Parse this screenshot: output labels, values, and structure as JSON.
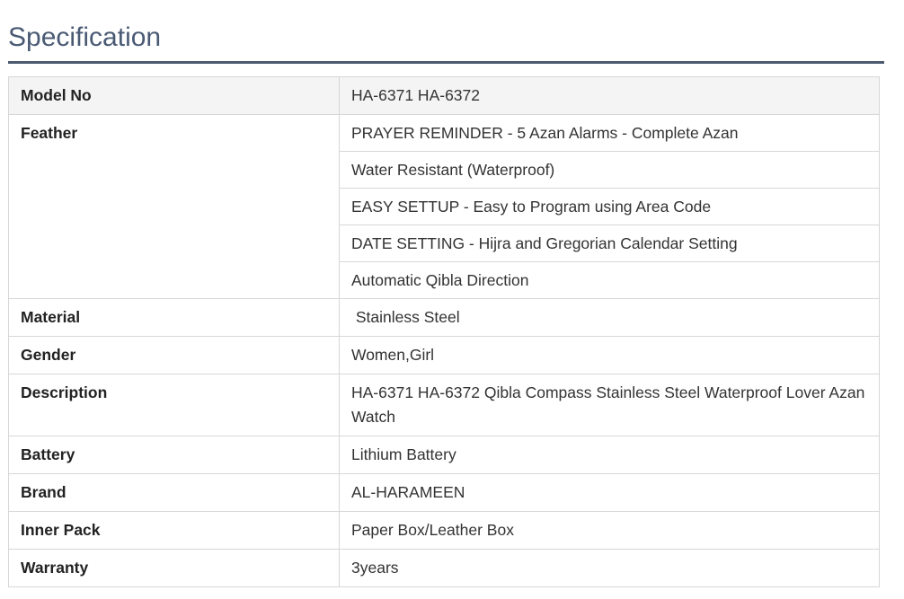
{
  "section": {
    "title": "Specification"
  },
  "specs": {
    "model": {
      "label": "Model No",
      "value": "HA-6371 HA-6372"
    },
    "feather": {
      "label": "Feather",
      "values": [
        "PRAYER REMINDER - 5 Azan Alarms - Complete Azan",
        "Water Resistant (Waterproof)",
        "EASY SETTUP - Easy to Program using Area Code",
        "DATE SETTING - Hijra and Gregorian Calendar Setting",
        "Automatic Qibla Direction"
      ]
    },
    "material": {
      "label": "Material",
      "value": " Stainless Steel"
    },
    "gender": {
      "label": "Gender",
      "value": "Women,Girl"
    },
    "description": {
      "label": "Description",
      "value": "HA-6371 HA-6372 Qibla Compass Stainless Steel Waterproof Lover Azan Watch"
    },
    "battery": {
      "label": "Battery",
      "value": "Lithium Battery"
    },
    "brand": {
      "label": "Brand",
      "value": "AL-HARAMEEN"
    },
    "inner_pack": {
      "label": "Inner Pack",
      "value": "Paper Box/Leather Box"
    },
    "warranty": {
      "label": "Warranty",
      "value": "3years"
    }
  }
}
